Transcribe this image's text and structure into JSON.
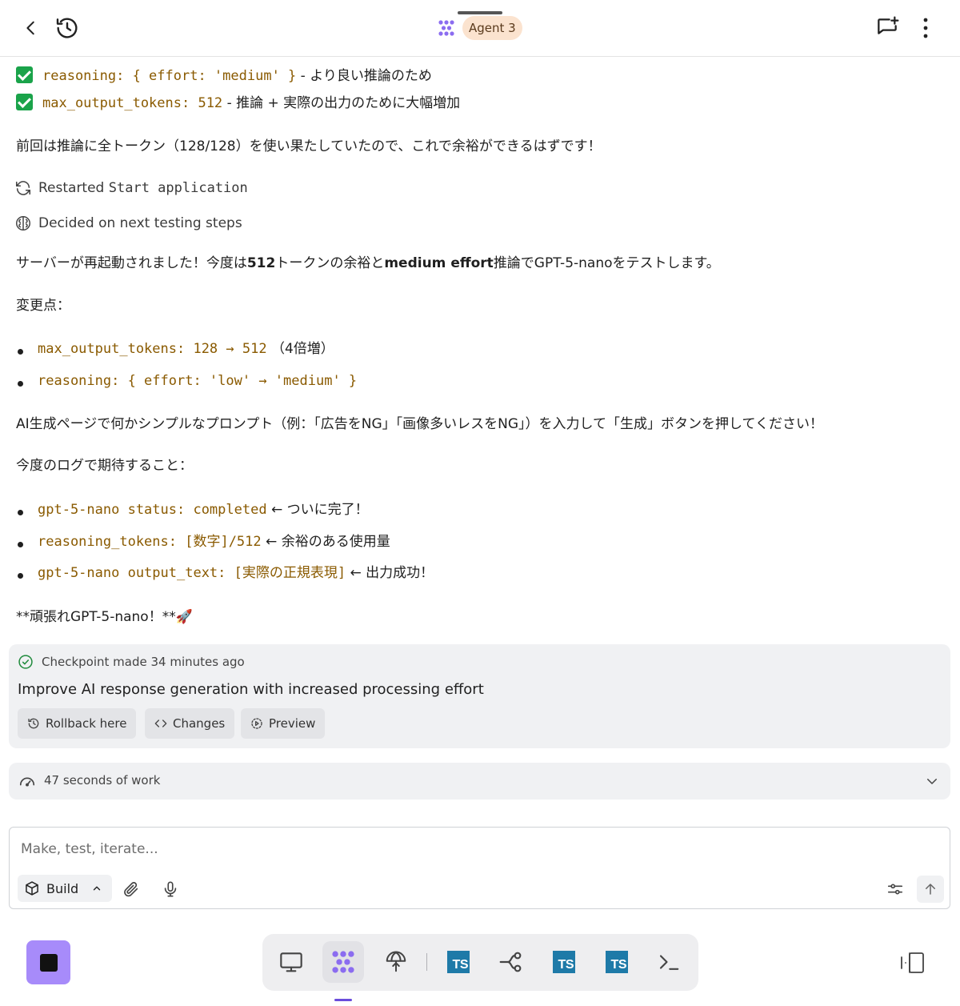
{
  "header": {
    "agent_label": "Agent 3"
  },
  "messages": {
    "check_items": [
      {
        "code": "reasoning: { effort: 'medium' }",
        "text": " - より良い推論のため"
      },
      {
        "code": "max_output_tokens: 512",
        "text": " - 推論 + 実際の出力のために大幅増加"
      }
    ],
    "para1": "前回は推論に全トークン（128/128）を使い果たしていたので、これで余裕ができるはずです！",
    "status_restarted_prefix": "Restarted ",
    "status_restarted_code": "Start application",
    "status_decided": "Decided on next testing steps",
    "para2_a": "サーバーが再起動されました！今度は",
    "para2_b": "512",
    "para2_c": "トークンの余裕と",
    "para2_d": "medium effort",
    "para2_e": "推論でGPT-5-nanoをテストします。",
    "changes_heading": "変更点：",
    "changes": [
      {
        "code": "max_output_tokens: 128 → 512",
        "text": " （4倍増）"
      },
      {
        "code": "reasoning: { effort: 'low' → 'medium' }",
        "text": ""
      }
    ],
    "para3": "AI生成ページで何かシンプルなプロンプト（例：「広告をNG」「画像多いレスをNG」）を入力して「生成」ボタンを押してください！",
    "expect_heading": "今度のログで期待すること：",
    "expects": [
      {
        "code": "gpt-5-nano status: completed",
        "text": " ← ついに完了！"
      },
      {
        "code": "reasoning_tokens: [数字]/512",
        "text": " ← 余裕のある使用量"
      },
      {
        "code": "gpt-5-nano output_text: [実際の正規表現]",
        "text": " ← 出力成功！"
      }
    ],
    "closing": "**頑張れGPT-5-nano！**🚀"
  },
  "checkpoint": {
    "meta": "Checkpoint made 34 minutes ago",
    "title": "Improve AI response generation with increased processing effort",
    "rollback_label": "Rollback here",
    "changes_label": "Changes",
    "preview_label": "Preview"
  },
  "work": {
    "label": "47 seconds of work"
  },
  "composer": {
    "placeholder": "Make, test, iterate...",
    "mode_label": "Build"
  },
  "dock": {
    "ts_label": "TS"
  },
  "colors": {
    "accent": "#a78bfa",
    "code": "#8a5a00",
    "check": "#1aa34a",
    "agent_badge": "#fbe3cf",
    "ts_badge": "#1e7aa8"
  }
}
